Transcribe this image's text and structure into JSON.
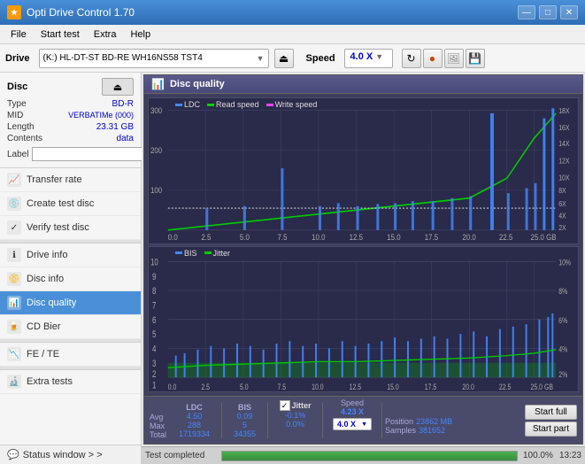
{
  "app": {
    "title": "Opti Drive Control 1.70",
    "icon": "★"
  },
  "titlebar": {
    "minimize": "—",
    "maximize": "□",
    "close": "✕"
  },
  "menu": {
    "items": [
      "File",
      "Start test",
      "Extra",
      "Help"
    ]
  },
  "drivebar": {
    "label": "Drive",
    "drive_value": "(K:)  HL-DT-ST BD-RE  WH16NS58 TST4",
    "speed_label": "Speed",
    "speed_value": "4.0 X"
  },
  "disc": {
    "title": "Disc",
    "type_label": "Type",
    "type_value": "BD-R",
    "mid_label": "MID",
    "mid_value": "VERBATIMe (000)",
    "length_label": "Length",
    "length_value": "23.31 GB",
    "contents_label": "Contents",
    "contents_value": "data",
    "label_label": "Label",
    "label_value": ""
  },
  "nav": {
    "items": [
      {
        "id": "transfer-rate",
        "label": "Transfer rate",
        "icon": "📈"
      },
      {
        "id": "create-test-disc",
        "label": "Create test disc",
        "icon": "💿"
      },
      {
        "id": "verify-test-disc",
        "label": "Verify test disc",
        "icon": "✓"
      },
      {
        "id": "drive-info",
        "label": "Drive info",
        "icon": "ℹ"
      },
      {
        "id": "disc-info",
        "label": "Disc info",
        "icon": "📀"
      },
      {
        "id": "disc-quality",
        "label": "Disc quality",
        "icon": "📊",
        "active": true
      },
      {
        "id": "cd-bier",
        "label": "CD Bier",
        "icon": "🍺"
      },
      {
        "id": "fe-te",
        "label": "FE / TE",
        "icon": "📉"
      },
      {
        "id": "extra-tests",
        "label": "Extra tests",
        "icon": "🔬"
      }
    ],
    "status_window": "Status window  > >"
  },
  "quality": {
    "panel_title": "Disc quality",
    "legend_ldc": "LDC",
    "legend_read": "Read speed",
    "legend_write": "Write speed",
    "legend_bis": "BIS",
    "legend_jitter": "Jitter",
    "chart1_ymax": "300",
    "chart1_y200": "200",
    "chart1_y100": "100",
    "chart1_xvals": [
      "0.0",
      "2.5",
      "5.0",
      "7.5",
      "10.0",
      "12.5",
      "15.0",
      "17.5",
      "20.0",
      "22.5",
      "25.0 GB"
    ],
    "chart1_right_yvals": [
      "18X",
      "16X",
      "14X",
      "12X",
      "10X",
      "8X",
      "6X",
      "4X",
      "2X"
    ],
    "chart2_ymax": "10",
    "chart2_xvals": [
      "0.0",
      "2.5",
      "5.0",
      "7.5",
      "10.0",
      "12.5",
      "15.0",
      "17.5",
      "20.0",
      "22.5",
      "25.0 GB"
    ],
    "chart2_right_yvals": [
      "10%",
      "8%",
      "6%",
      "4%",
      "2%"
    ],
    "stats": {
      "ldc_header": "LDC",
      "bis_header": "BIS",
      "jitter_header": "Jitter",
      "avg_label": "Avg",
      "max_label": "Max",
      "total_label": "Total",
      "avg_ldc": "4.50",
      "avg_bis": "0.09",
      "avg_jitter": "-0.1%",
      "max_ldc": "288",
      "max_bis": "5",
      "max_jitter": "0.0%",
      "total_ldc": "1719334",
      "total_bis": "34355",
      "speed_label": "Speed",
      "speed_value": "4.23 X",
      "speed_select": "4.0 X",
      "position_label": "Position",
      "position_value": "23862 MB",
      "samples_label": "Samples",
      "samples_value": "381652"
    },
    "btn_start_full": "Start full",
    "btn_start_part": "Start part"
  },
  "progress": {
    "status": "Test completed",
    "percent": "100.0%",
    "fill_pct": 100,
    "time": "13:23"
  }
}
